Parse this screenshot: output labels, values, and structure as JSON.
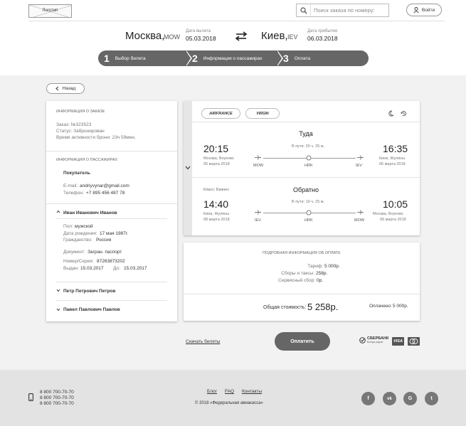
{
  "header": {
    "logo_label": "Логотип",
    "search_placeholder": "Поиск заказа по номеру:",
    "login_label": "Войти"
  },
  "route": {
    "from_city": "Москва,",
    "from_code": "MOW",
    "depart_label": "Дата вылета",
    "depart_date": "05.03.2018",
    "to_city": "Киев,",
    "to_code": "IEV",
    "arrive_label": "Дата прибытия",
    "arrive_date": "06.03.2018"
  },
  "steps": [
    {
      "num": "1",
      "label": "Выбор билета"
    },
    {
      "num": "2",
      "label": "Информация о пассажирах"
    },
    {
      "num": "3",
      "label": "Оплата"
    }
  ],
  "back_label": "Назад",
  "order": {
    "title": "ИНФОРМАЦИЯ О ЗАКАЗЕ",
    "number": "Заказ: №323523",
    "status": "Статус: Забронирован",
    "active_time": "Время активности брони: 23ч 59мин."
  },
  "passengers": {
    "title": "ИНФОРМАЦИЯ О ПАССАЖИРАХ",
    "buyer_title": "Покупатель",
    "email_label": "E-mail:",
    "email": "andriyvynar@gmail.com",
    "phone_label": "Телефон:",
    "phone": "+7 895 456 487 78",
    "p1_name": "Иван Иванович Иванов",
    "p1_sex_label": "Пол:",
    "p1_sex": "мужской",
    "p1_birth_label": "Дата рождения:",
    "p1_birth": "17 мая 1987г.",
    "p1_cit_label": "Гражданство:",
    "p1_cit": "Россия",
    "p1_doc_label": "Документ:",
    "p1_doc": "Загран. паспорт",
    "p1_num_label": "Номер/Серия:",
    "p1_num": "87263873202",
    "p1_issued_label": "Выдан:",
    "p1_issued": "15.03.2017",
    "p1_till_label": "До:",
    "p1_till": "15.03.2017",
    "p2_name": "Петр Петрович Петров",
    "p3_name": "Павел Павлович Павлов"
  },
  "flights": {
    "airline1": "AIRFRANCE",
    "airline2": "VIRGIN",
    "out": {
      "title": "Туда",
      "depart_time": "20:15",
      "depart_place": "Москва, Внуково",
      "depart_date": "05 марта 2018",
      "duration": "В пути: 20 ч. 25 м.",
      "arrive_time": "16:35",
      "arrive_place": "Киев, Жуляны",
      "arrive_date": "06 марта 2018",
      "codes": [
        "MOW",
        "HRK",
        "IEV"
      ]
    },
    "back": {
      "class": "Класс: Бизнес",
      "title": "Обратно",
      "depart_time": "14:40",
      "depart_place": "Киев, Жуляны",
      "depart_date": "08 марта 2018",
      "duration": "В пути: 19 ч. 25 м.",
      "arrive_time": "10:05",
      "arrive_place": "Москва, Внуково",
      "arrive_date": "09 марта 2018",
      "codes": [
        "IEV",
        "HRK",
        "MOW"
      ]
    }
  },
  "payment": {
    "title": "ПОДРОБНАЯ ИНФОРМАЦИЯ ОБ ОПЛАТЕ",
    "tariff_label": "Тариф:",
    "tariff": "5 000р.",
    "fees_label": "Сборы и таксы:",
    "fees": "258р.",
    "service_label": "Сервисный сбор:",
    "service": "0р.",
    "total_label": "Общая стоимость:",
    "total": "5 258р.",
    "paid_label": "Оплачено:",
    "paid": "5 000р."
  },
  "actions": {
    "download_label": "Скачать билеты",
    "pay_label": "Оплатить",
    "bank_label": "СБЕРБАНК",
    "bank_sub": "Всегда рядом",
    "visa_label": "VISA"
  },
  "footer": {
    "phones": [
      "8 800 700-70-70",
      "8 800 700-70-70",
      "8 800 700-70-70"
    ],
    "links": [
      "Блог",
      "FAQ",
      "Контакты"
    ],
    "copyright": "© 2018 «Федеральная авиакасса»",
    "social": [
      "f",
      "vk",
      "G",
      "t"
    ]
  },
  "colors": {
    "accent": "#666666",
    "grey_bg": "#f2f2f2",
    "footer_bg": "#e3e3e3"
  }
}
